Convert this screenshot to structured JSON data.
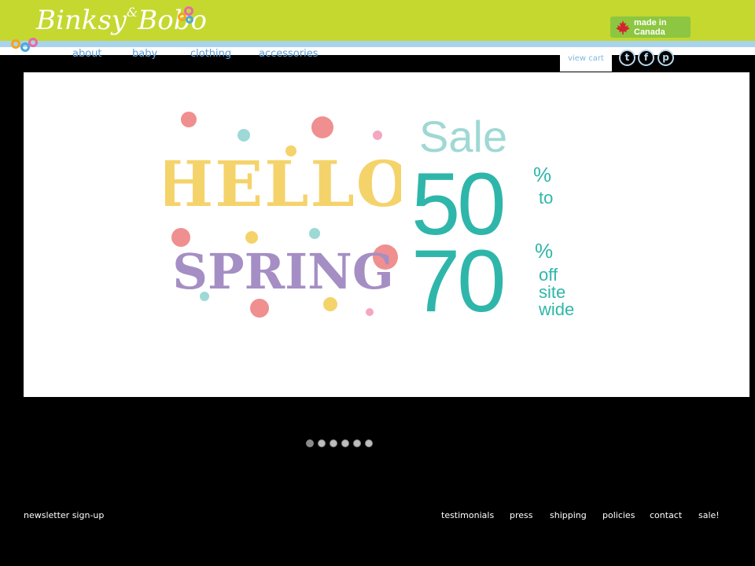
{
  "brand": {
    "logo_text": "Binksy",
    "logo_amp": "&",
    "logo_text2": "Bobo"
  },
  "badge": {
    "line1": "made in",
    "line2": "Canada"
  },
  "nav": [
    {
      "label": "about"
    },
    {
      "label": "baby"
    },
    {
      "label": "clothing"
    },
    {
      "label": "accessories"
    }
  ],
  "cart": {
    "label": "view cart"
  },
  "social": [
    {
      "icon": "twitter-icon",
      "glyph": "t"
    },
    {
      "icon": "facebook-icon",
      "glyph": "f"
    },
    {
      "icon": "pinterest-icon",
      "glyph": "p"
    }
  ],
  "banner": {
    "hello": "HELLO",
    "spring": "SPRING",
    "sale": "Sale",
    "num1": "50",
    "pct": "%",
    "to": "to",
    "num2": "70",
    "off": "off",
    "site": "site",
    "wide": "wide"
  },
  "slider": {
    "dot_count": 6,
    "active_index": 0
  },
  "footer": {
    "newsletter": "newsletter sign-up",
    "links": [
      "testimonials",
      "press",
      "shipping",
      "policies",
      "contact",
      "sale!"
    ]
  },
  "colors": {
    "header_green": "#c4d82f",
    "stripe_blue": "#a9d3ea",
    "nav_blue": "#5e9ed6",
    "badge_green": "#8dc640",
    "teal": "#2fb6aa",
    "light_teal": "#9fd8d4"
  }
}
